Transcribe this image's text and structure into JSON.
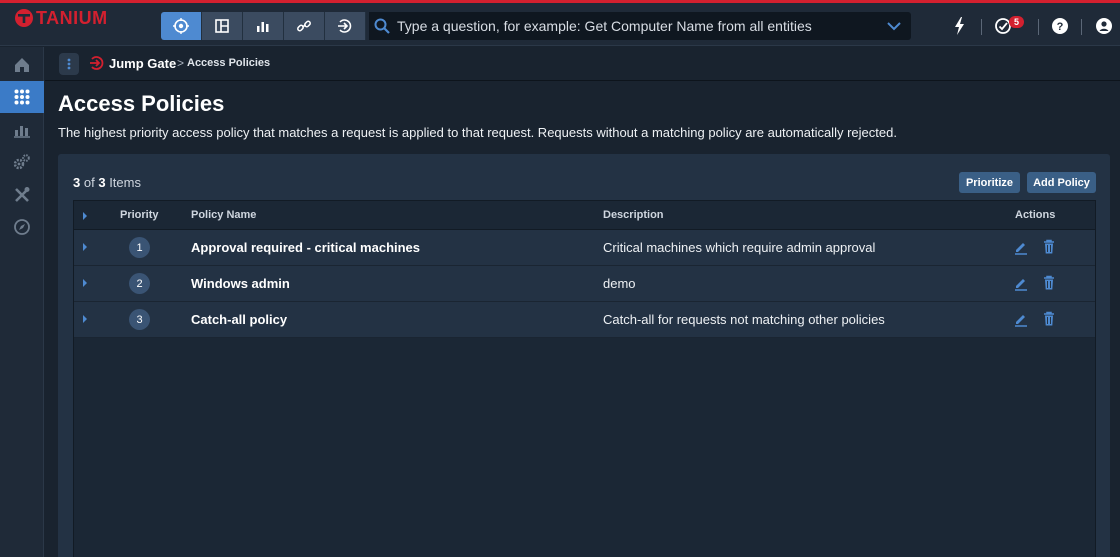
{
  "app": {
    "logo_text": "TANIUM"
  },
  "search": {
    "placeholder": "Type a question, for example: Get Computer Name from all entities"
  },
  "notifications": {
    "count": "5"
  },
  "breadcrumb": {
    "module": "Jump Gate",
    "separator": ">",
    "current": "Access Policies"
  },
  "page": {
    "title": "Access Policies",
    "description": "The highest priority access policy that matches a request is applied to that request. Requests without a matching policy are automatically rejected."
  },
  "toolbar": {
    "count_shown": "3",
    "count_of": "of",
    "count_total": "3",
    "count_label": "Items",
    "prioritize_label": "Prioritize",
    "add_policy_label": "Add Policy"
  },
  "table": {
    "columns": {
      "priority": "Priority",
      "name": "Policy Name",
      "description": "Description",
      "actions": "Actions"
    },
    "rows": [
      {
        "priority": "1",
        "name": "Approval required - critical machines",
        "description": "Critical machines which require admin approval"
      },
      {
        "priority": "2",
        "name": "Windows admin",
        "description": "demo"
      },
      {
        "priority": "3",
        "name": "Catch-all policy",
        "description": "Catch-all for requests not matching other policies"
      }
    ]
  },
  "icons": {
    "nav": [
      "target-icon",
      "dashboard-icon",
      "bar-chart-icon",
      "link-icon",
      "deploy-icon"
    ],
    "top_right": [
      "lightning-icon",
      "tasks-icon",
      "help-icon",
      "user-icon"
    ],
    "sidebar": [
      "home-icon",
      "modules-grid-icon",
      "reports-icon",
      "admin-gears-icon",
      "tools-icon",
      "compass-icon"
    ],
    "row_actions": [
      "edit-icon",
      "delete-icon"
    ]
  },
  "colors": {
    "brand": "#d3202f",
    "accent": "#4e8ad1",
    "button": "#3a5f86"
  }
}
